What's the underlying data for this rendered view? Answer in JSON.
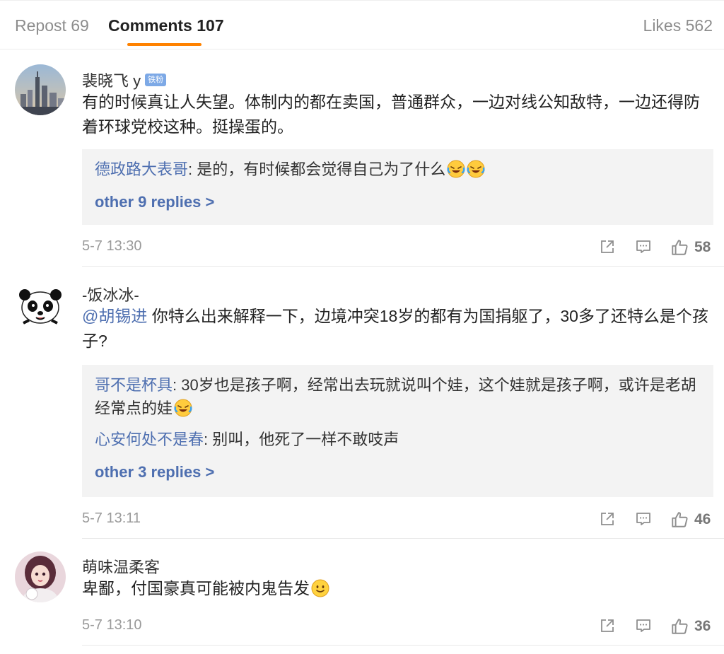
{
  "tabs": {
    "repost": "Repost 69",
    "comments": "Comments 107",
    "likes": "Likes 562"
  },
  "accent_color": "#ff8200",
  "link_color": "#4e6fb0",
  "comments": [
    {
      "username": "裴晓飞 y",
      "badge": "铁粉",
      "text": "有的时候真让人失望。体制内的都在卖国，普通群众，一边对线公知敌特，一边还得防着环球党校这种。挺操蛋的。",
      "replies": [
        {
          "author": "德政路大表哥",
          "text": ": 是的，有时候都会觉得自己为了什么"
        }
      ],
      "more_replies": "other 9 replies >",
      "time": "5-7 13:30",
      "likes": "58"
    },
    {
      "username": "-饭冰冰-",
      "mention": "@胡锡进",
      "text": " 你特么出来解释一下，边境冲突18岁的都有为国捐躯了，30多了还特么是个孩子?",
      "replies": [
        {
          "author": "哥不是杯具",
          "text": ": 30岁也是孩子啊，经常出去玩就说叫个娃，这个娃就是孩子啊，或许是老胡经常点的娃"
        },
        {
          "author": "心安何处不是春",
          "text": ": 别叫，他死了一样不敢吱声"
        }
      ],
      "more_replies": "other 3 replies >",
      "time": "5-7 13:11",
      "likes": "46"
    },
    {
      "username": "萌味温柔客",
      "text": "卑鄙，付国豪真可能被内鬼告发",
      "time": "5-7 13:10",
      "likes": "36"
    }
  ],
  "icons": [
    "share-icon",
    "comment-icon",
    "like-icon",
    "laugh-cry-emoji",
    "smile-emoji"
  ]
}
